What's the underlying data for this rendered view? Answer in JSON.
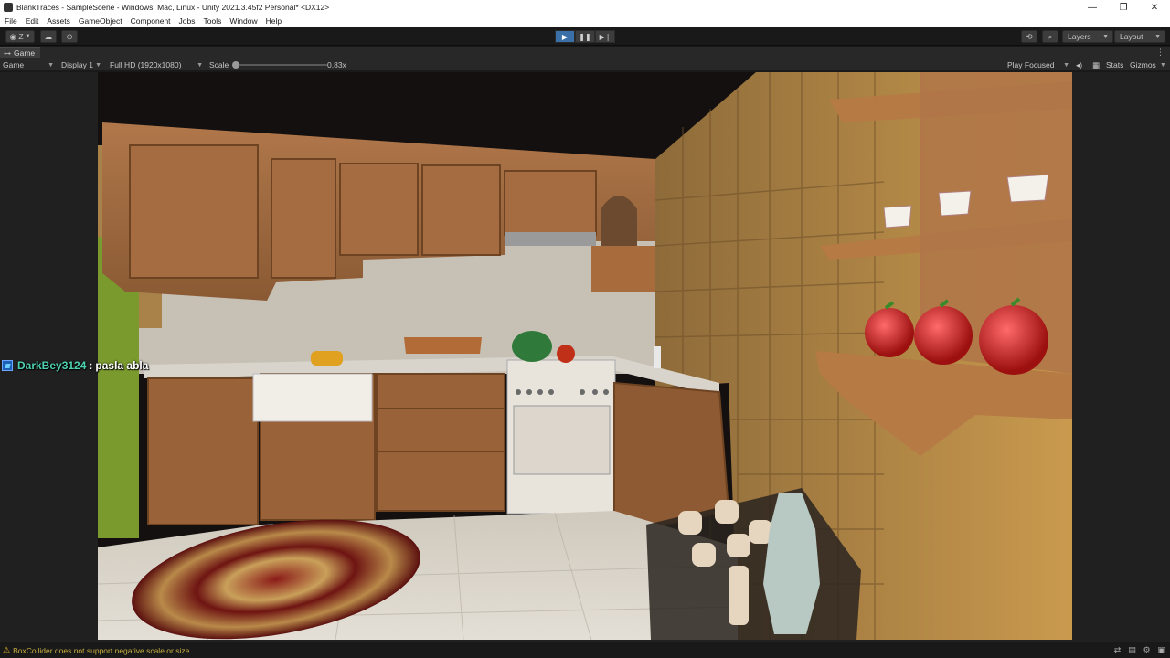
{
  "window": {
    "title": "BlankTraces - SampleScene - Windows, Mac, Linux - Unity 2021.3.45f2 Personal* <DX12>",
    "controls": {
      "minimize": "—",
      "maximize": "❐",
      "close": "✕"
    }
  },
  "menu": [
    "File",
    "Edit",
    "Assets",
    "GameObject",
    "Component",
    "Jobs",
    "Tools",
    "Window",
    "Help"
  ],
  "toolbar": {
    "account_label": "Z",
    "layers_label": "Layers",
    "layout_label": "Layout",
    "play_state": "playing",
    "icons": [
      "account-icon",
      "cloud-icon",
      "collab-icon",
      "play-icon",
      "pause-icon",
      "step-icon",
      "history-icon",
      "search-icon"
    ]
  },
  "tab": {
    "label": "Game",
    "icon": "gamepad-icon"
  },
  "gamebar": {
    "view_select": "Game",
    "display": "Display 1",
    "resolution": "Full HD (1920x1080)",
    "scale_label": "Scale",
    "scale_value": "0.83x",
    "play_mode": "Play Focused",
    "stats": "Stats",
    "gizmos": "Gizmos"
  },
  "chat_overlay": {
    "user": "DarkBey3124",
    "separator": ":",
    "message": "pasla abla"
  },
  "status": {
    "message": "BoxCollider does not support negative scale or size.",
    "level": "warning"
  },
  "colors": {
    "editor_bg": "#191919",
    "play_active": "#3a6fa8",
    "chat_user": "#4ed1b0",
    "status_warning": "#e8b325"
  }
}
